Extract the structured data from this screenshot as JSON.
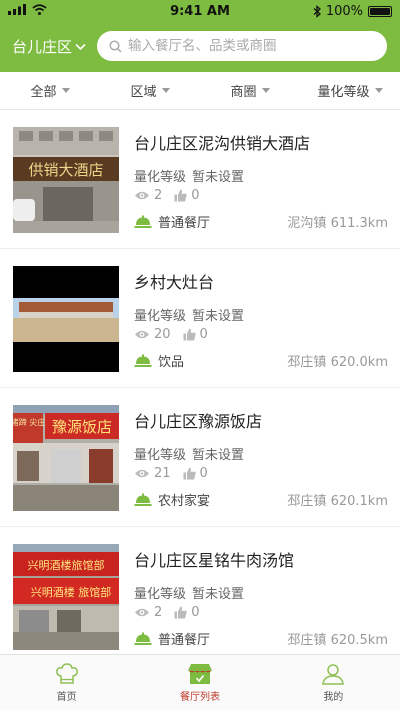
{
  "status_bar": {
    "time": "9:41 AM",
    "battery": "100%"
  },
  "header": {
    "city": "台儿庄区",
    "search_placeholder": "输入餐厅名、品类或商圈"
  },
  "filters": [
    {
      "label": "全部"
    },
    {
      "label": "区域"
    },
    {
      "label": "商圈"
    },
    {
      "label": "量化等级"
    }
  ],
  "restaurants": [
    {
      "name": "台儿庄区泥沟供销大酒店",
      "level_label": "量化等级",
      "level_value": "暂未设置",
      "views": "2",
      "likes": "0",
      "category": "普通餐厅",
      "town": "泥沟镇",
      "distance": "611.3km"
    },
    {
      "name": "乡村大灶台",
      "level_label": "量化等级",
      "level_value": "暂未设置",
      "views": "20",
      "likes": "0",
      "category": "饮品",
      "town": "邳庄镇",
      "distance": "620.0km"
    },
    {
      "name": "台儿庄区豫源饭店",
      "level_label": "量化等级",
      "level_value": "暂未设置",
      "views": "21",
      "likes": "0",
      "category": "农村家宴",
      "town": "邳庄镇",
      "distance": "620.1km"
    },
    {
      "name": "台儿庄区星铭牛肉汤馆",
      "level_label": "量化等级",
      "level_value": "暂未设置",
      "views": "2",
      "likes": "0",
      "category": "普通餐厅",
      "town": "邳庄镇",
      "distance": "620.5km"
    }
  ],
  "photo_signs": {
    "r0": "供销大酒店",
    "r2_main": "豫源饭店",
    "r2_left": "猪蹄 尖庄",
    "r3_top": "兴明酒楼旅馆部",
    "r3_main": "兴明酒楼 旅馆部"
  },
  "tabs": [
    {
      "label": "首页",
      "icon": "chef-hat-icon"
    },
    {
      "label": "餐厅列表",
      "icon": "shop-icon"
    },
    {
      "label": "我的",
      "icon": "user-icon"
    }
  ],
  "colors": {
    "header_green": "#7dbb41",
    "active_tab": "#c0392b",
    "icon_green": "#7dbb41"
  }
}
